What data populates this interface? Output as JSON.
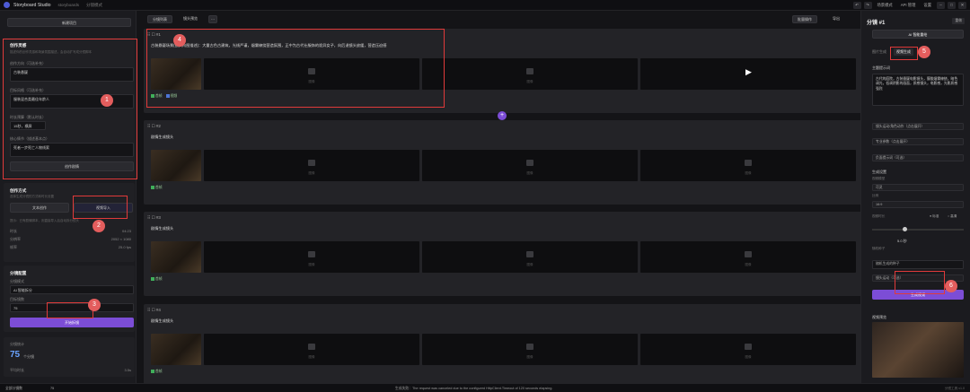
{
  "app": {
    "title": "Storyboard Studio",
    "project": "storyboards",
    "breadcrumb": "分镜模式",
    "buttons": [
      "场景模式",
      "API 管理",
      "设置"
    ]
  },
  "left": {
    "new_project": "新建项目",
    "card1": {
      "title": "创作灵感",
      "hint": "描述你的创作灵感和场景氛围描述，会自动扩写成分镜脚本",
      "label1": "创作方向（可选补充）",
      "value1": "古装悬疑",
      "label2": "目标风格（可选补充）",
      "value2": "服装混合类最佳年龄人",
      "label3": "时长预算（默认时长）",
      "value3": "15秒，横屏",
      "label4": "核心情节（描述基本点）",
      "value4": "死者一步死亡人物线索",
      "button": "创作剧情"
    },
    "card2": {
      "title": "创作方式",
      "hint": "选择生成分镜的方式和时长设置",
      "tab1": "文本创作",
      "tab2": "视频导入",
      "note": "提示：已有剧情脚本，则直接导入后自动拆分镜头",
      "rows": [
        [
          "时长",
          "04:23"
        ],
        [
          "分辨率",
          "2052 × 1080"
        ],
        [
          "帧率",
          "25.0 fps"
        ]
      ]
    },
    "card3": {
      "title": "分镜配置",
      "label1": "分镜模式",
      "select1": "AI 智能拆分",
      "label2": "目标镜数",
      "value2": "75",
      "button": "开始拆镜"
    },
    "result": {
      "label": "分镜统计",
      "count": "75",
      "unit": "个分镜",
      "label2": "平均时长",
      "value2": "3.5s"
    }
  },
  "center": {
    "tabs": [
      "分镜列表",
      "镜头预览"
    ],
    "toolbar_right": [
      "批量操作",
      "导出"
    ],
    "shots": [
      {
        "id": "#1",
        "desc": "古装悬疑场景(镜头构图描述)：大量古色古建筑，光线严谨，烟雾缭绕营造氛围，正中为古代仕服饰的诡异女子，向后退镜头放缓，营造压迫感",
        "thumb_label": "图像",
        "tags": [
          "首帧",
          "视频"
        ]
      },
      {
        "id": "#2",
        "desc": "剧情生成镜头",
        "thumb_label": "图像",
        "tags": [
          "首帧"
        ]
      },
      {
        "id": "#3",
        "desc": "剧情生成镜头",
        "thumb_label": "图像",
        "tags": [
          "首帧"
        ]
      },
      {
        "id": "#4",
        "desc": "剧情生成镜头",
        "thumb_label": "图像",
        "tags": [
          "首帧"
        ]
      }
    ]
  },
  "right": {
    "title": "分镜 #1",
    "badge": "重做",
    "ai_button": "AI 智能重绘",
    "tabs": [
      "图片生成",
      "视频生成"
    ],
    "prompt_label": "主题提示词",
    "prompt": "古代的庭院，古装悬疑电影镜头，朦胧烟雾缭绕，暗色调光，低调阴影的画面，质感镜头，电影感，光影质感强烈",
    "rows": [
      "镜头运动/角色动作（点击展开）",
      "专业参数（点击展开）",
      "负面提示词（可选）"
    ],
    "gen_label": "生成设置",
    "model_label": "视频模型",
    "model": "可灵",
    "ratio_label": "比例",
    "ratio": "16:9",
    "dur_label": "视频时长",
    "dur": "5.0 秒",
    "radio": [
      "标准",
      "高清"
    ],
    "seed_label": "随机种子",
    "seed": "随机生成的种子",
    "neg_label": "镜头运动（可选）",
    "gen_button": "生成视频",
    "preview_label": "视频预览"
  },
  "status": {
    "left": "全部分镜数",
    "count": "75",
    "message": "生成失败：The request was canceled due to the configured HttpClient.Timeout of 120 seconds elapsing.",
    "version": "分镜工具 v1.0"
  },
  "annotations": [
    "1",
    "2",
    "3",
    "4",
    "5",
    "6"
  ]
}
